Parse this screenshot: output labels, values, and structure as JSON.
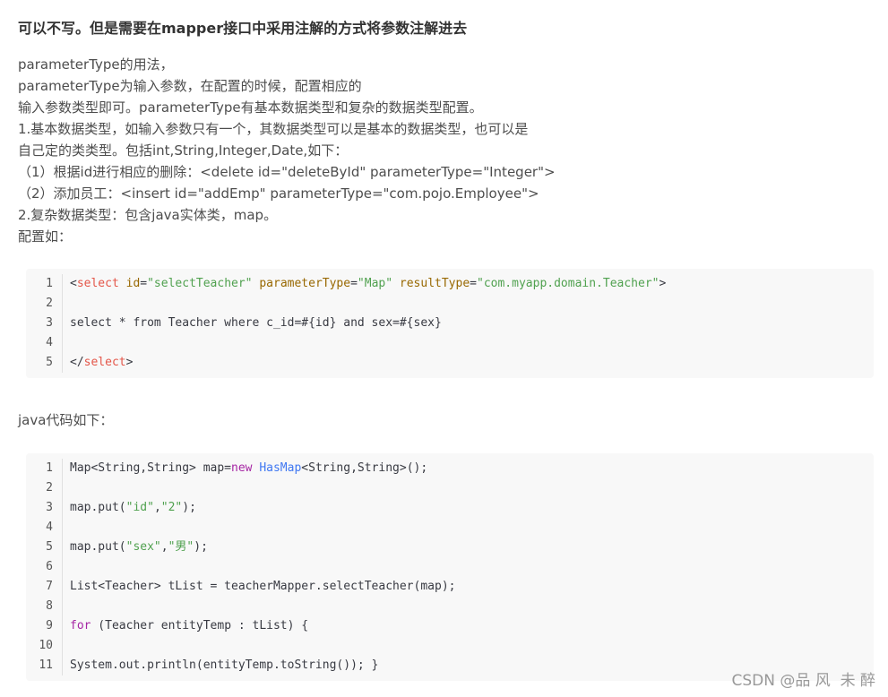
{
  "heading": "可以不写。但是需要在mapper接口中采用注解的方式将参数注解进去",
  "paragraph_lines": [
    "parameterType的用法，",
    "parameterType为输入参数，在配置的时候，配置相应的",
    "输入参数类型即可。parameterType有基本数据类型和复杂的数据类型配置。",
    "1.基本数据类型，如输入参数只有一个，其数据类型可以是基本的数据类型，也可以是",
    "自己定的类类型。包括int,String,Integer,Date,如下：",
    "（1）根据id进行相应的删除：<delete id=\"deleteById\" parameterType=\"Integer\">",
    "（2）添加员工：<insert id=\"addEmp\" parameterType=\"com.pojo.Employee\">",
    "2.复杂数据类型：包含java实体类，map。",
    "配置如："
  ],
  "xml_code": {
    "line_numbers": [
      "1",
      "2",
      "3",
      "4",
      "5"
    ],
    "line1": {
      "open": "<",
      "tag": "select",
      "attr1": "id",
      "eq": "=",
      "val1": "\"selectTeacher\"",
      "attr2": "parameterType",
      "val2": "\"Map\"",
      "attr3": "resultType",
      "val3": "\"com.myapp.domain.Teacher\"",
      "close": ">"
    },
    "line3": "select * from Teacher where c_id=#{id} and sex=#{sex}",
    "line5": {
      "open": "</",
      "tag": "select",
      "close": ">"
    }
  },
  "java_subheading": "java代码如下：",
  "java_code": {
    "line_numbers": [
      "1",
      "2",
      "3",
      "4",
      "5",
      "6",
      "7",
      "8",
      "9",
      "10",
      "11"
    ],
    "line1": {
      "a": "Map<String,String> map=",
      "kw": "new",
      "sp": " ",
      "cls": "HasMap",
      "b": "<String,String>();"
    },
    "line3": {
      "a": "map.put(",
      "s1": "\"id\"",
      "comma": ",",
      "s2": "\"2\"",
      "b": ");"
    },
    "line5": {
      "a": "map.put(",
      "s1": "\"sex\"",
      "comma": ",",
      "s2": "\"男\"",
      "b": ");"
    },
    "line7": "List<Teacher> tList = teacherMapper.selectTeacher(map);",
    "line9": {
      "kw": "for",
      "b": " (Teacher entityTemp : tList) {"
    },
    "line11": "System.out.println(entityTemp.toString()); }"
  },
  "watermark": "CSDN @品 风 ‍ 未 醉"
}
